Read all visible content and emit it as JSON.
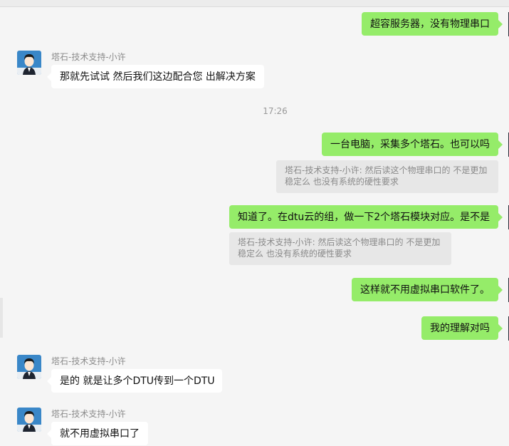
{
  "timestamp": "17:26",
  "sender_name": "塔石-技术支持-小许",
  "messages": {
    "m1": "超容服务器，没有物理串口",
    "m2": "那就先试试 然后我们这边配合您 出解决方案",
    "m3": "一台电脑，采集多个塔石。也可以吗",
    "q1": "塔石-技术支持-小许: 然后读这个物理串口的  不是更加稳定么  也没有系统的硬性要求",
    "m4": "知道了。在dtu云的组，做一下2个塔石模块对应。是不是",
    "q2": "塔石-技术支持-小许: 然后读这个物理串口的  不是更加稳定么  也没有系统的硬性要求",
    "m5": "这样就不用虚拟串口软件了。",
    "m6": "我的理解对吗",
    "m7": "是的 就是让多个DTU传到一个DTU",
    "m8": "就不用虚拟串口了"
  },
  "colors": {
    "self_bubble": "#95ec69",
    "other_bubble": "#ffffff",
    "quote_bg": "#e7e7e7",
    "background": "#f5f5f5"
  }
}
